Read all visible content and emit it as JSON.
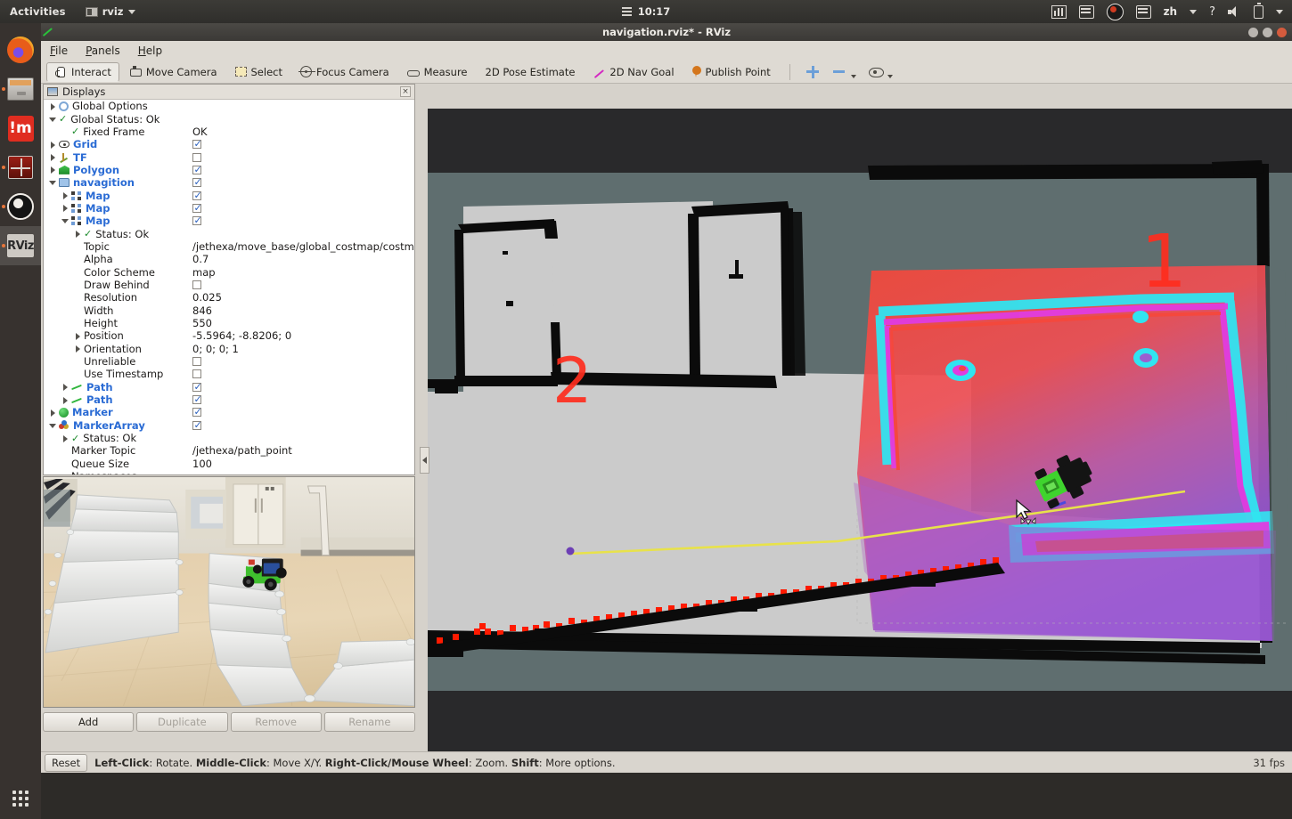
{
  "system": {
    "activities": "Activities",
    "app_menu": "rviz",
    "clock": "10:17",
    "tray": {
      "lang": "zh",
      "help": "?"
    },
    "launcher_items": [
      {
        "name": "firefox",
        "label": "Firefox"
      },
      {
        "name": "files",
        "label": "Files"
      },
      {
        "name": "im",
        "label": "!m"
      },
      {
        "name": "red-app",
        "label": "App"
      },
      {
        "name": "obs",
        "label": "OBS Studio"
      },
      {
        "name": "rviz",
        "label": "RViz"
      }
    ],
    "show_apps": "Show Applications"
  },
  "window": {
    "title": "navigation.rviz* - RViz"
  },
  "menu": [
    {
      "label": "File",
      "accel": "F"
    },
    {
      "label": "Panels",
      "accel": "P"
    },
    {
      "label": "Help",
      "accel": "H"
    }
  ],
  "toolbar": {
    "buttons": [
      {
        "label": "Interact",
        "icon": "hand-icon",
        "active": true
      },
      {
        "label": "Move Camera",
        "icon": "move-camera-icon",
        "active": false
      },
      {
        "label": "Select",
        "icon": "select-icon",
        "active": false
      },
      {
        "label": "Focus Camera",
        "icon": "focus-camera-icon",
        "active": false
      },
      {
        "label": "Measure",
        "icon": "measure-icon",
        "active": false
      },
      {
        "label": "2D Pose Estimate",
        "icon": "pose-estimate-icon",
        "active": false
      },
      {
        "label": "2D Nav Goal",
        "icon": "nav-goal-icon",
        "active": false
      },
      {
        "label": "Publish Point",
        "icon": "publish-point-icon",
        "active": false
      }
    ],
    "extra": [
      {
        "name": "add-tool-button",
        "icon": "plus-icon"
      },
      {
        "name": "remove-tool-button",
        "icon": "minus-icon"
      },
      {
        "name": "tool-properties-button",
        "icon": "eye-icon"
      }
    ]
  },
  "displays_panel": {
    "title": "Displays",
    "close_label": "×",
    "rows": [
      {
        "indent": 0,
        "expander": "right",
        "icon": "gear-icon",
        "label": "Global Options",
        "bold": false,
        "value_type": "none"
      },
      {
        "indent": 0,
        "expander": "down",
        "icon": "check-icon",
        "label": "Global Status: Ok",
        "bold": false,
        "value_type": "none"
      },
      {
        "indent": 1,
        "expander": "none",
        "icon": "check-icon",
        "label": "Fixed Frame",
        "bold": false,
        "value_type": "text",
        "value": "OK"
      },
      {
        "indent": 0,
        "expander": "right",
        "icon": "eye-icon",
        "label": "Grid",
        "bold": true,
        "value_type": "checkbox",
        "checked": true
      },
      {
        "indent": 0,
        "expander": "right",
        "icon": "tf-icon",
        "label": "TF",
        "bold": true,
        "value_type": "checkbox",
        "checked": false
      },
      {
        "indent": 0,
        "expander": "right",
        "icon": "polygon-icon",
        "label": "Polygon",
        "bold": true,
        "value_type": "checkbox",
        "checked": true
      },
      {
        "indent": 0,
        "expander": "down",
        "icon": "folder-icon",
        "label": "navagition",
        "bold": true,
        "value_type": "checkbox",
        "checked": true
      },
      {
        "indent": 1,
        "expander": "right",
        "icon": "map-icon",
        "label": "Map",
        "bold": true,
        "value_type": "checkbox",
        "checked": true
      },
      {
        "indent": 1,
        "expander": "right",
        "icon": "map-icon",
        "label": "Map",
        "bold": true,
        "value_type": "checkbox",
        "checked": true
      },
      {
        "indent": 1,
        "expander": "down",
        "icon": "map-icon",
        "label": "Map",
        "bold": true,
        "value_type": "checkbox",
        "checked": true
      },
      {
        "indent": 2,
        "expander": "right",
        "icon": "check-icon",
        "label": "Status: Ok",
        "bold": false,
        "value_type": "none"
      },
      {
        "indent": 2,
        "expander": "none",
        "icon": "none",
        "label": "Topic",
        "bold": false,
        "value_type": "text",
        "value": "/jethexa/move_base/global_costmap/costmap"
      },
      {
        "indent": 2,
        "expander": "none",
        "icon": "none",
        "label": "Alpha",
        "bold": false,
        "value_type": "text",
        "value": "0.7"
      },
      {
        "indent": 2,
        "expander": "none",
        "icon": "none",
        "label": "Color Scheme",
        "bold": false,
        "value_type": "text",
        "value": "map"
      },
      {
        "indent": 2,
        "expander": "none",
        "icon": "none",
        "label": "Draw Behind",
        "bold": false,
        "value_type": "checkbox",
        "checked": false
      },
      {
        "indent": 2,
        "expander": "none",
        "icon": "none",
        "label": "Resolution",
        "bold": false,
        "value_type": "text",
        "value": "0.025"
      },
      {
        "indent": 2,
        "expander": "none",
        "icon": "none",
        "label": "Width",
        "bold": false,
        "value_type": "text",
        "value": "846"
      },
      {
        "indent": 2,
        "expander": "none",
        "icon": "none",
        "label": "Height",
        "bold": false,
        "value_type": "text",
        "value": "550"
      },
      {
        "indent": 2,
        "expander": "right",
        "icon": "none",
        "label": "Position",
        "bold": false,
        "value_type": "text",
        "value": "-5.5964; -8.8206; 0"
      },
      {
        "indent": 2,
        "expander": "right",
        "icon": "none",
        "label": "Orientation",
        "bold": false,
        "value_type": "text",
        "value": "0; 0; 0; 1"
      },
      {
        "indent": 2,
        "expander": "none",
        "icon": "none",
        "label": "Unreliable",
        "bold": false,
        "value_type": "checkbox",
        "checked": false
      },
      {
        "indent": 2,
        "expander": "none",
        "icon": "none",
        "label": "Use Timestamp",
        "bold": false,
        "value_type": "checkbox",
        "checked": false
      },
      {
        "indent": 1,
        "expander": "right",
        "icon": "path-icon",
        "label": "Path",
        "bold": true,
        "value_type": "checkbox",
        "checked": true
      },
      {
        "indent": 1,
        "expander": "right",
        "icon": "path-icon",
        "label": "Path",
        "bold": true,
        "value_type": "checkbox",
        "checked": true
      },
      {
        "indent": 0,
        "expander": "right",
        "icon": "marker-icon",
        "label": "Marker",
        "bold": true,
        "value_type": "checkbox",
        "checked": true
      },
      {
        "indent": 0,
        "expander": "down",
        "icon": "marker-array-icon",
        "label": "MarkerArray",
        "bold": true,
        "value_type": "checkbox",
        "checked": true
      },
      {
        "indent": 1,
        "expander": "right",
        "icon": "check-icon",
        "label": "Status: Ok",
        "bold": false,
        "value_type": "none"
      },
      {
        "indent": 1,
        "expander": "none",
        "icon": "none",
        "label": "Marker Topic",
        "bold": false,
        "value_type": "text",
        "value": "/jethexa/path_point"
      },
      {
        "indent": 1,
        "expander": "none",
        "icon": "none",
        "label": "Queue Size",
        "bold": false,
        "value_type": "text",
        "value": "100"
      },
      {
        "indent": 1,
        "expander": "down",
        "icon": "none",
        "label": "Namespaces",
        "bold": false,
        "value_type": "none"
      }
    ]
  },
  "panel_buttons": [
    {
      "label": "Add",
      "enabled": true
    },
    {
      "label": "Duplicate",
      "enabled": false
    },
    {
      "label": "Remove",
      "enabled": false
    },
    {
      "label": "Rename",
      "enabled": false
    }
  ],
  "statusbar": {
    "reset_label": "Reset",
    "hint_parts": [
      {
        "text": "Left-Click",
        "bold": true
      },
      {
        "text": ": Rotate. ",
        "bold": false
      },
      {
        "text": "Middle-Click",
        "bold": true
      },
      {
        "text": ": Move X/Y. ",
        "bold": false
      },
      {
        "text": "Right-Click/Mouse Wheel",
        "bold": true
      },
      {
        "text": ": Zoom. ",
        "bold": false
      },
      {
        "text": "Shift",
        "bold": true
      },
      {
        "text": ": More options.",
        "bold": false
      }
    ],
    "fps": "31 fps"
  },
  "viewport": {
    "markers": [
      {
        "name": "waypoint-1",
        "text": "1",
        "color": "#ff2d1e"
      },
      {
        "name": "waypoint-2",
        "text": "2",
        "color": "#ff2d1e"
      }
    ],
    "colors": {
      "background": "#29292b",
      "unknown_space": "#5f6e6f",
      "free_space": "#cccccc",
      "occupied": "#000000",
      "costmap_lethal": "#ff4b4b",
      "costmap_inflation_inner": "#e03ce0",
      "costmap_inflation_outer": "#31e4f0",
      "costmap_mid": "#9b5fd0",
      "laser_scan": "#ff1a00",
      "global_path": "#e8e24a",
      "local_path": "#d429c2"
    }
  }
}
